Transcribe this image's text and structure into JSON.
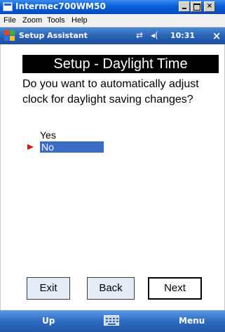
{
  "window": {
    "title": "Intermec700WM50",
    "controls": {
      "minimize": "minimize-icon",
      "maximize": "maximize-icon",
      "close": "×"
    }
  },
  "menubar": {
    "items": [
      "File",
      "Zoom",
      "Tools",
      "Help"
    ]
  },
  "wm_topbar": {
    "app_title": "Setup Assistant",
    "connectivity_glyph": "⇄",
    "volume_glyph": "◂(",
    "time": "10:31",
    "close_glyph": "×",
    "start_icon": "windows-flag-icon"
  },
  "content": {
    "page_title": "Setup - Daylight Time",
    "question": "Do you want to automatically adjust clock for daylight saving changes?",
    "options": [
      {
        "label": "Yes",
        "selected": false
      },
      {
        "label": "No",
        "selected": true
      }
    ],
    "buttons": {
      "exit": "Exit",
      "back": "Back",
      "next": "Next"
    }
  },
  "softkeys": {
    "left": "Up",
    "center_icon": "keyboard-icon",
    "right": "Menu"
  },
  "colors": {
    "title_bar": "#0a5fd8",
    "wm_bar": "#2a62b4",
    "selection": "#3a6cc4",
    "selection_arrow": "#d01818",
    "button_face": "#e4ecf8"
  }
}
